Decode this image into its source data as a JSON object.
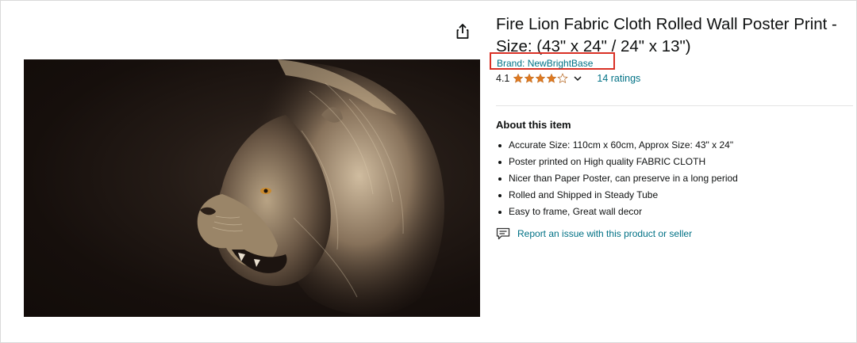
{
  "product": {
    "title": "Fire Lion Fabric Cloth Rolled Wall Poster Print - Size: (43\" x 24\" / 24\" x 13\")",
    "brand_link": "Brand: NewBrightBase",
    "rating_value": "4.1",
    "stars_filled": 4,
    "stars_total": 5,
    "ratings_count_label": "14 ratings",
    "image_icon": "lion-poster-image",
    "share_icon": "share-icon"
  },
  "about": {
    "heading": "About this item",
    "bullets": [
      "Accurate Size: 110cm x 60cm, Approx Size: 43\" x 24\"",
      "Poster printed on High quality FABRIC CLOTH",
      "Nicer than Paper Poster, can preserve in a long period",
      "Rolled and Shipped in Steady Tube",
      "Easy to frame, Great wall decor"
    ]
  },
  "report": {
    "label": "Report an issue with this product or seller",
    "icon": "feedback-icon"
  },
  "colors": {
    "link": "#007185",
    "star": "#de7921",
    "highlight_box": "#d93025",
    "text": "#0f1111"
  }
}
